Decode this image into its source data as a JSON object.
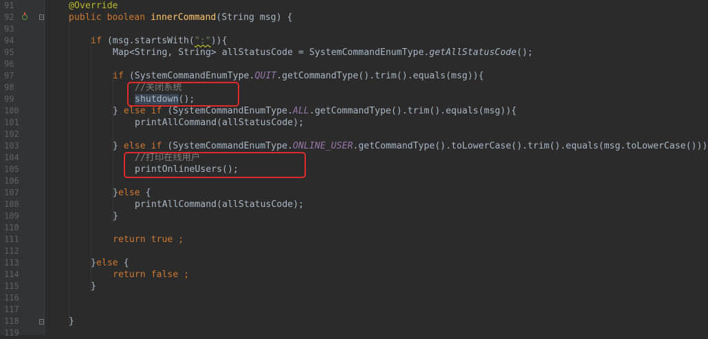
{
  "gutter": {
    "line_numbers": [
      "91",
      "92",
      "93",
      "94",
      "95",
      "96",
      "97",
      "98",
      "99",
      "100",
      "101",
      "102",
      "103",
      "104",
      "105",
      "106",
      "107",
      "108",
      "109",
      "110",
      "111",
      "112",
      "113",
      "114",
      "115",
      "116",
      "117",
      "118",
      "119"
    ]
  },
  "code": {
    "l91": {
      "t1": "@Override"
    },
    "l92": {
      "t1": "public boolean ",
      "t2": "innerCommand",
      "t3": "(String msg) {"
    },
    "l94": {
      "t1": "if ",
      "t2": "(msg.startsWith(",
      "t3": "\":\"",
      "t4": ")){"
    },
    "l95": {
      "t1": "Map<String, String> allStatusCode = SystemCommandEnumType.",
      "t2": "getAllStatusCode",
      "t3": "();"
    },
    "l97": {
      "t1": "if ",
      "t2": "(SystemCommandEnumType.",
      "t3": "QUIT",
      "t4": ".getCommandType().trim().equals(msg)){"
    },
    "l98": {
      "t1": "//关闭系统"
    },
    "l99": {
      "t1": "shutdown",
      "t2": "();"
    },
    "l100": {
      "t1": "} ",
      "t2": "else if ",
      "t3": "(SystemCommandEnumType.",
      "t4": "ALL",
      "t5": ".getCommandType().trim().equals(msg)){"
    },
    "l101": {
      "t1": "printAllCommand(allStatusCode);"
    },
    "l103": {
      "t1": "} ",
      "t2": "else if ",
      "t3": "(SystemCommandEnumType.",
      "t4": "ONLINE_USER",
      "t5": ".getCommandType().toLowerCase().trim().equals(msg.toLowerCase()))"
    },
    "l104": {
      "t1": "//打印在线用户"
    },
    "l105": {
      "t1": "printOnlineUsers();"
    },
    "l107": {
      "t1": "}",
      "t2": "else ",
      "t3": "{"
    },
    "l108": {
      "t1": "printAllCommand(allStatusCode);"
    },
    "l109": {
      "t1": "}"
    },
    "l111": {
      "t1": "return true ;"
    },
    "l113": {
      "t1": "}",
      "t2": "else ",
      "t3": "{"
    },
    "l114": {
      "t1": "return false ;"
    },
    "l115": {
      "t1": "}"
    },
    "l118": {
      "t1": "}"
    }
  },
  "colors": {
    "background": "#2b2b2b",
    "keyword": "#cc7832",
    "annotation": "#bbb529",
    "method": "#ffc66d",
    "constant": "#9876aa",
    "string": "#6a8759",
    "comment": "#808080",
    "highlight_box": "#e02b2b"
  },
  "icons": [
    "override-marker-icon",
    "fold-icon"
  ]
}
